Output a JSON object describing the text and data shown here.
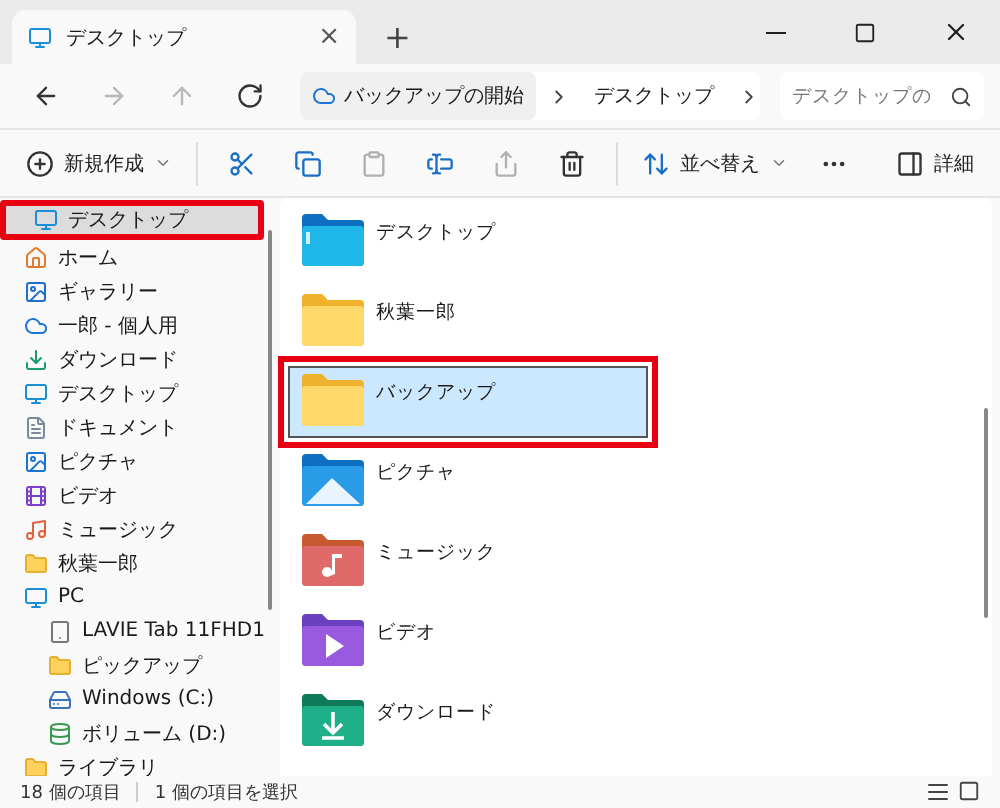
{
  "window": {
    "tab_title": "デスクトップ",
    "tab_close": "×",
    "new_tab": "+"
  },
  "nav": [
    {
      "kind": "back",
      "disabled": false
    },
    {
      "kind": "forward",
      "disabled": true
    },
    {
      "kind": "up",
      "disabled": true
    },
    {
      "kind": "refresh",
      "disabled": false
    }
  ],
  "breadcrumb": [
    {
      "kind": "backup",
      "label": "バックアップの開始"
    },
    {
      "kind": "folder",
      "label": "デスクトップ"
    }
  ],
  "search": {
    "placeholder": "デスクトップの"
  },
  "toolbar": [
    {
      "kind": "new",
      "label": "新規作成",
      "disabled": false
    },
    {
      "kind": "cut",
      "disabled": false
    },
    {
      "kind": "copy",
      "disabled": false
    },
    {
      "kind": "paste",
      "disabled": true
    },
    {
      "kind": "rename",
      "disabled": false
    },
    {
      "kind": "share",
      "disabled": true
    },
    {
      "kind": "delete",
      "disabled": false
    },
    {
      "kind": "sort",
      "label": "並べ替え",
      "disabled": false
    },
    {
      "kind": "more",
      "disabled": false
    },
    {
      "kind": "details",
      "label": "詳細",
      "disabled": false
    }
  ],
  "sidebar": [
    {
      "kind": "desktop",
      "label": "デスクトップ",
      "selected": true,
      "annotated": true
    },
    {
      "kind": "home",
      "label": "ホーム",
      "selected": false,
      "annotated": false
    },
    {
      "kind": "gallery",
      "label": "ギャラリー",
      "selected": false,
      "annotated": false
    },
    {
      "kind": "cloud",
      "label": "一郎 - 個人用",
      "selected": false,
      "annotated": false
    },
    {
      "kind": "download",
      "label": "ダウンロード",
      "selected": false,
      "annotated": false
    },
    {
      "kind": "desktop",
      "label": "デスクトップ",
      "selected": false,
      "annotated": false
    },
    {
      "kind": "document",
      "label": "ドキュメント",
      "selected": false,
      "annotated": false
    },
    {
      "kind": "pictures",
      "label": "ピクチャ",
      "selected": false,
      "annotated": false
    },
    {
      "kind": "video",
      "label": "ビデオ",
      "selected": false,
      "annotated": false
    },
    {
      "kind": "music",
      "label": "ミュージック",
      "selected": false,
      "annotated": false
    },
    {
      "kind": "folder",
      "label": "秋葉一郎",
      "selected": false,
      "annotated": false
    },
    {
      "kind": "pc",
      "label": "PC",
      "selected": false,
      "annotated": false,
      "children": [
        {
          "kind": "device",
          "label": "LAVIE Tab 11FHD1",
          "selected": false,
          "annotated": false
        },
        {
          "kind": "folder",
          "label": "ピックアップ",
          "selected": false,
          "annotated": false
        },
        {
          "kind": "drive",
          "label": "Windows (C:)",
          "selected": false,
          "annotated": false
        },
        {
          "kind": "volume",
          "label": "ボリューム (D:)",
          "selected": false,
          "annotated": false
        }
      ]
    },
    {
      "kind": "folder",
      "label": "ライブラリ",
      "selected": false,
      "annotated": false
    }
  ],
  "files": [
    {
      "kind": "desktop",
      "label": "デスクトップ",
      "selected": false,
      "annotated": false
    },
    {
      "kind": "folder",
      "label": "秋葉一郎",
      "selected": false,
      "annotated": false
    },
    {
      "kind": "folder",
      "label": "バックアップ",
      "selected": true,
      "annotated": true
    },
    {
      "kind": "pictures",
      "label": "ピクチャ",
      "selected": false,
      "annotated": false
    },
    {
      "kind": "music",
      "label": "ミュージック",
      "selected": false,
      "annotated": false
    },
    {
      "kind": "video",
      "label": "ビデオ",
      "selected": false,
      "annotated": false
    },
    {
      "kind": "download",
      "label": "ダウンロード",
      "selected": false,
      "annotated": false
    }
  ],
  "status_bar": {
    "count": "18 個の項目",
    "selection": "1 個の項目を選択"
  }
}
